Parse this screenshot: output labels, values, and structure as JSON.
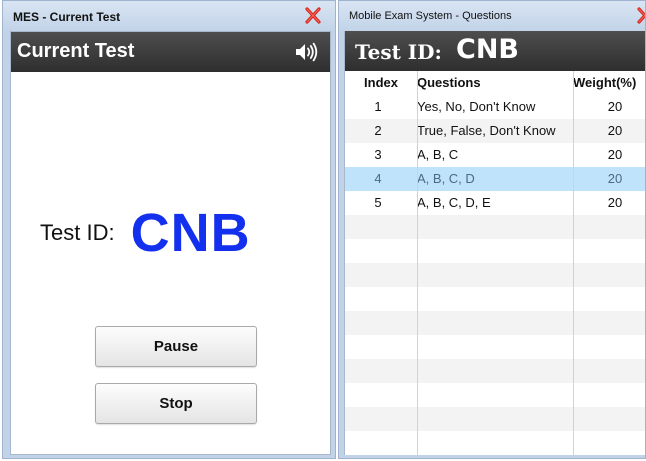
{
  "left_window": {
    "title": "MES - Current Test",
    "header_title": "Current Test",
    "test_id_label": "Test ID:",
    "test_id_value": "CNB",
    "pause_label": "Pause",
    "stop_label": "Stop",
    "close_icon": "close-x-icon",
    "speaker_icon": "speaker-icon"
  },
  "right_window": {
    "title": "Mobile Exam System - Questions",
    "header_label": "Test ID:",
    "header_value": "CNB",
    "close_icon": "close-x-icon",
    "table": {
      "columns": [
        "Index",
        "Questions",
        "Weight(%)"
      ],
      "rows": [
        {
          "index": "1",
          "questions": "Yes, No, Don't Know",
          "weight": "20"
        },
        {
          "index": "2",
          "questions": "True, False, Don't Know",
          "weight": "20"
        },
        {
          "index": "3",
          "questions": "A, B, C",
          "weight": "20"
        },
        {
          "index": "4",
          "questions": "A, B, C, D",
          "weight": "20"
        },
        {
          "index": "5",
          "questions": "A, B, C, D, E",
          "weight": "20"
        }
      ],
      "selected_row_index": 3
    }
  },
  "colors": {
    "window_frame": "#c2d3e8",
    "header_bar": "#3a3a3a",
    "test_id_value": "#1230ee",
    "selected_row": "#bfe3fa",
    "close_icon": "#d9261c"
  }
}
